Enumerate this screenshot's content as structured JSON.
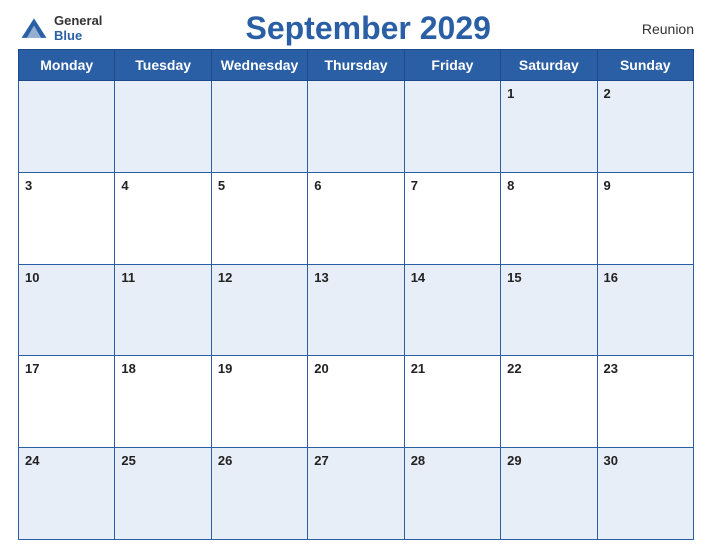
{
  "logo": {
    "general": "General",
    "blue": "Blue"
  },
  "title": "September 2029",
  "region": "Reunion",
  "days_of_week": [
    "Monday",
    "Tuesday",
    "Wednesday",
    "Thursday",
    "Friday",
    "Saturday",
    "Sunday"
  ],
  "weeks": [
    [
      {
        "num": "",
        "empty": true
      },
      {
        "num": "",
        "empty": true
      },
      {
        "num": "",
        "empty": true
      },
      {
        "num": "",
        "empty": true
      },
      {
        "num": "",
        "empty": true
      },
      {
        "num": "1"
      },
      {
        "num": "2"
      }
    ],
    [
      {
        "num": "3"
      },
      {
        "num": "4"
      },
      {
        "num": "5"
      },
      {
        "num": "6"
      },
      {
        "num": "7"
      },
      {
        "num": "8"
      },
      {
        "num": "9"
      }
    ],
    [
      {
        "num": "10"
      },
      {
        "num": "11"
      },
      {
        "num": "12"
      },
      {
        "num": "13"
      },
      {
        "num": "14"
      },
      {
        "num": "15"
      },
      {
        "num": "16"
      }
    ],
    [
      {
        "num": "17"
      },
      {
        "num": "18"
      },
      {
        "num": "19"
      },
      {
        "num": "20"
      },
      {
        "num": "21"
      },
      {
        "num": "22"
      },
      {
        "num": "23"
      }
    ],
    [
      {
        "num": "24"
      },
      {
        "num": "25"
      },
      {
        "num": "26"
      },
      {
        "num": "27"
      },
      {
        "num": "28"
      },
      {
        "num": "29"
      },
      {
        "num": "30"
      }
    ]
  ]
}
